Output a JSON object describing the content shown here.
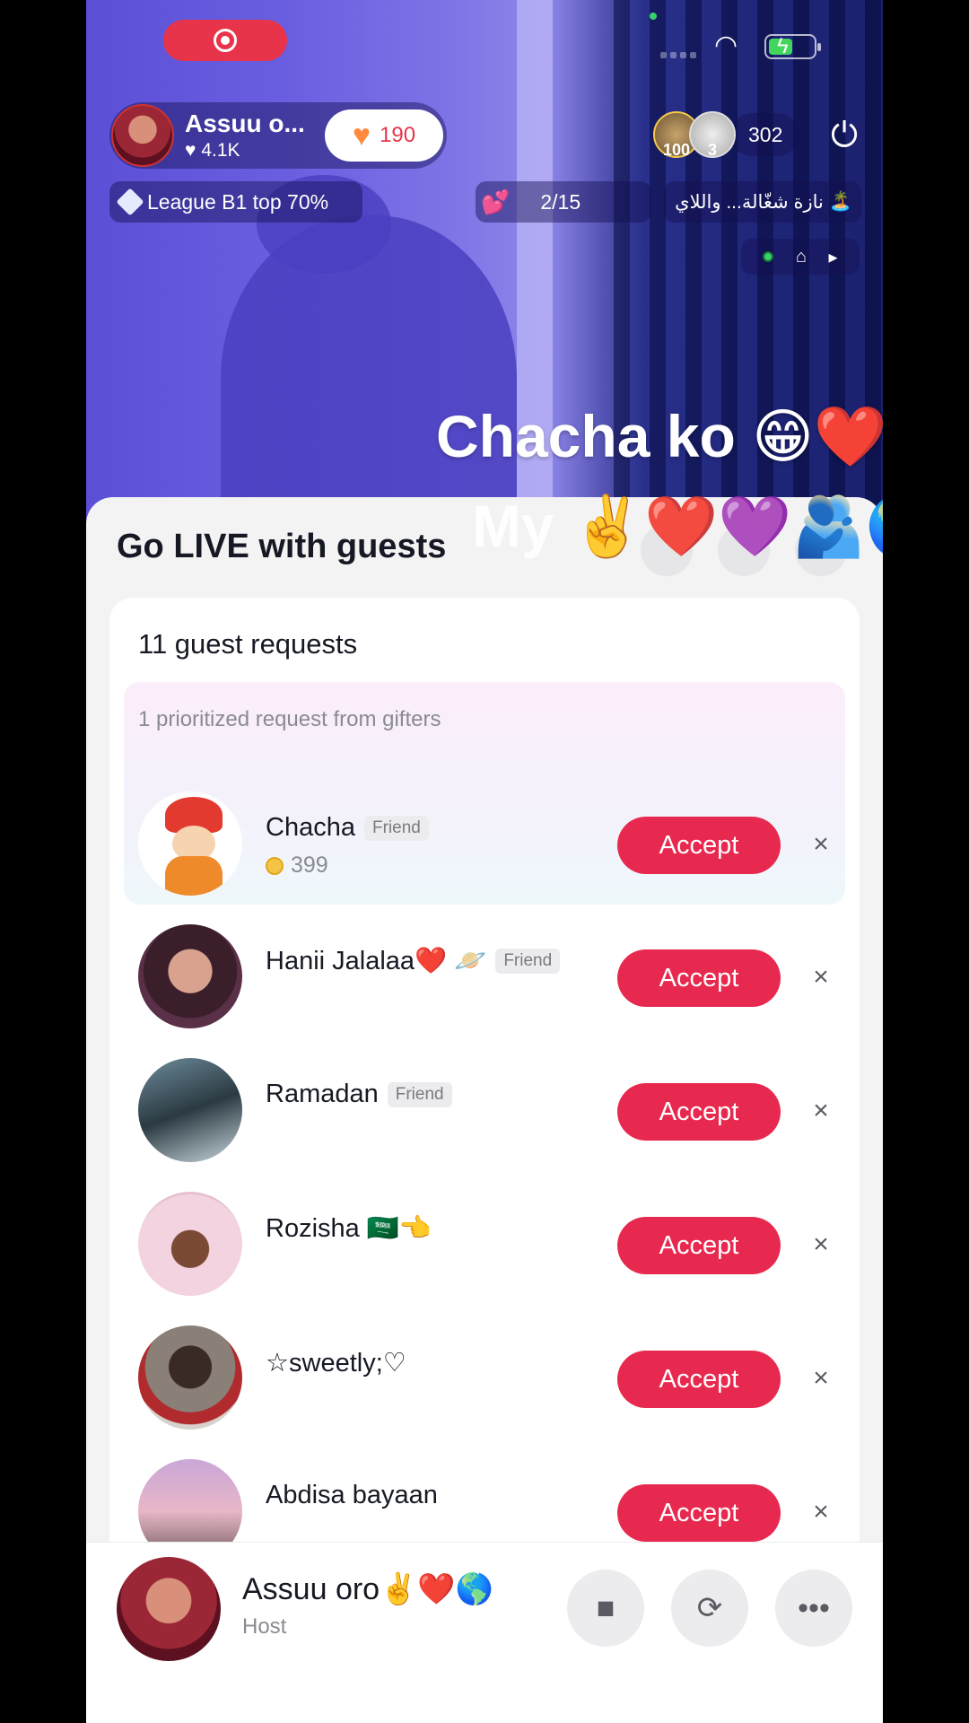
{
  "status_bar": {
    "wifi_icon": "wifi-icon",
    "battery_icon": "battery-charging-icon"
  },
  "host": {
    "name": "Assuu o...",
    "likes": "4.1K",
    "hearts": "190"
  },
  "viewers": {
    "avatar1_badge": "100",
    "avatar2_badge": "3",
    "count": "302"
  },
  "league": "League B1 top 70%",
  "progress": "2/15",
  "ticker": "نازة شغّالة... واللاي",
  "captions": {
    "line1": "Chacha ko 😁❤️",
    "line2": "My ✌️❤️💜🫂🌎"
  },
  "sheet": {
    "title": "Go LIVE with guests"
  },
  "requests": {
    "title": "11 guest requests",
    "prioritized_label": "1 prioritized request from gifters",
    "accept_label": "Accept",
    "close_glyph": "×",
    "items": [
      {
        "name": "Chacha",
        "badge": "Friend",
        "coins": "399"
      },
      {
        "name": "Hanii Jalalaa❤️ 🪐",
        "badge": "Friend"
      },
      {
        "name": "Ramadan",
        "badge": "Friend"
      },
      {
        "name": "Rozisha 🇸🇦👈"
      },
      {
        "name": "☆sweetly;♡"
      },
      {
        "name": "Abdisa bayaan"
      }
    ]
  },
  "footer": {
    "name": "Assuu oro✌️❤️🌎",
    "role": "Host"
  },
  "colors": {
    "accent": "#e8294f",
    "rec": "#e8344a",
    "heart": "#ff8a3d"
  }
}
